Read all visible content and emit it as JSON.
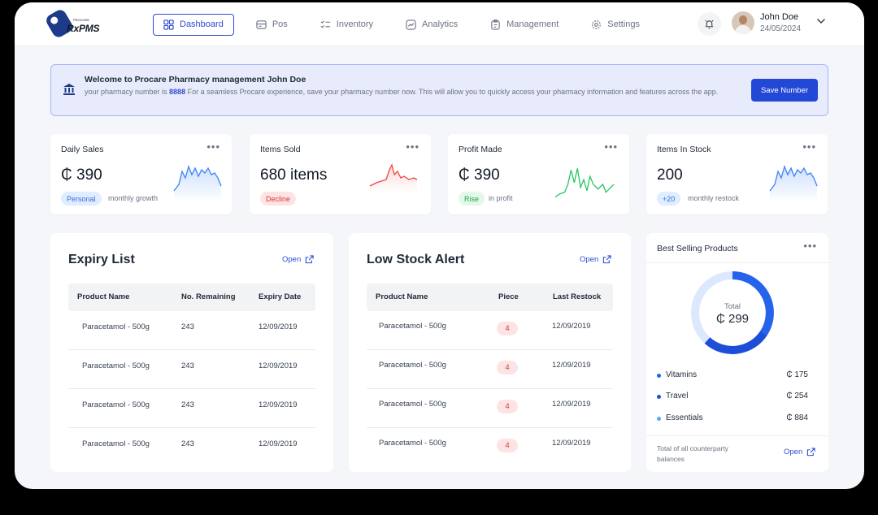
{
  "brand": {
    "name": "RxPMS",
    "tagline": "PROCURE"
  },
  "nav": [
    {
      "label": "Dashboard",
      "icon": "grid-icon",
      "active": true
    },
    {
      "label": "Pos",
      "icon": "pos-icon",
      "active": false
    },
    {
      "label": "Inventory",
      "icon": "checklist-icon",
      "active": false
    },
    {
      "label": "Analytics",
      "icon": "chart-icon",
      "active": false
    },
    {
      "label": "Management",
      "icon": "management-icon",
      "active": false
    },
    {
      "label": "Settings",
      "icon": "gear-icon",
      "active": false
    }
  ],
  "user": {
    "name": "John Doe",
    "date": "24/05/2024"
  },
  "banner": {
    "title": "Welcome to Procare Pharmacy management John Doe",
    "text_before": "your pharmacy number is ",
    "number": "8888",
    "text_after": " For a seamless Procare experience, save your pharmacy number now. This will allow you to quickly access your pharmacy information and features across the app.",
    "button": "Save Number"
  },
  "stats": [
    {
      "title": "Daily Sales",
      "value": "₵ 390",
      "pill": "Personal",
      "note": "monthly growth",
      "color": "#3b82f6"
    },
    {
      "title": "Items Sold",
      "value": "680 items",
      "pill": "Decline",
      "note": "",
      "color": "#ef4444"
    },
    {
      "title": "Profit Made",
      "value": "₵ 390",
      "pill": "Rise",
      "note": "in profit",
      "color": "#22c55e"
    },
    {
      "title": "Items In Stock",
      "value": "200",
      "pill": "+20",
      "note": "monthly restock",
      "color": "#3b82f6"
    }
  ],
  "expiry": {
    "title": "Expiry List",
    "open": "Open",
    "headers": [
      "Product Name",
      "No. Remaining",
      "Expiry Date"
    ],
    "rows": [
      [
        "Paracetamol - 500g",
        "243",
        "12/09/2019"
      ],
      [
        "Paracetamol - 500g",
        "243",
        "12/09/2019"
      ],
      [
        "Paracetamol - 500g",
        "243",
        "12/09/2019"
      ],
      [
        "Paracetamol - 500g",
        "243",
        "12/09/2019"
      ]
    ]
  },
  "low_stock": {
    "title": "Low Stock Alert",
    "open": "Open",
    "headers": [
      "Product Name",
      "Piece",
      "Last Restock"
    ],
    "rows": [
      [
        "Paracetamol - 500g",
        "4",
        "12/09/2019"
      ],
      [
        "Paracetamol - 500g",
        "4",
        "12/09/2019"
      ],
      [
        "Paracetamol - 500g",
        "4",
        "12/09/2019"
      ],
      [
        "Paracetamol - 500g",
        "4",
        "12/09/2019"
      ]
    ]
  },
  "best_selling": {
    "title": "Best Selling Products",
    "total_label": "Total",
    "total_value": "₵ 299",
    "items": [
      {
        "label": "Vitamins",
        "value": "₵ 175",
        "color": "#2563eb"
      },
      {
        "label": "Travel",
        "value": "₵ 254",
        "color": "#1d4ed8"
      },
      {
        "label": "Essentials",
        "value": "₵ 884",
        "color": "#60a5fa"
      }
    ],
    "footer": "Total of all counterparty balances",
    "open": "Open"
  }
}
